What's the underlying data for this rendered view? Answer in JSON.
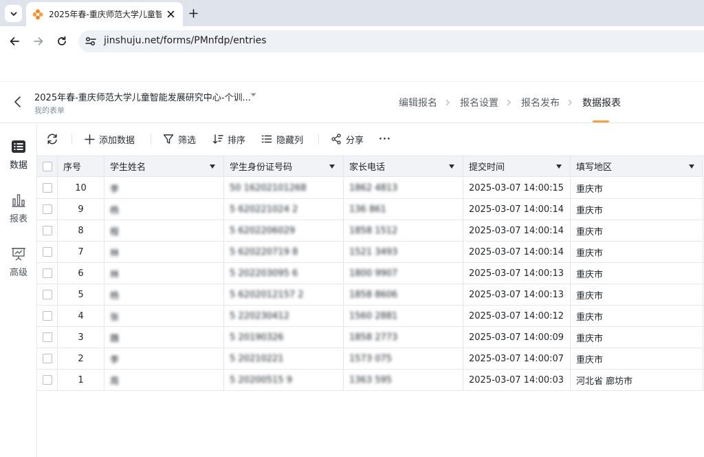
{
  "browser": {
    "tab_title": "2025年春-重庆师范大学儿童智",
    "url": "jinshuju.net/forms/PMnfdp/entries"
  },
  "header": {
    "form_title": "2025年春-重庆师范大学儿童智能发展研究中心-个训...",
    "subtitle": "我的表单",
    "steps": [
      "编辑报名",
      "报名设置",
      "报名发布",
      "数据报表"
    ],
    "active_step": "数据报表"
  },
  "rail": {
    "items": [
      {
        "label": "数据",
        "icon": "list-icon",
        "active": true
      },
      {
        "label": "报表",
        "icon": "bar-chart-icon",
        "active": false
      },
      {
        "label": "高级",
        "icon": "presentation-icon",
        "active": false
      }
    ]
  },
  "toolbar": {
    "add_label": "添加数据",
    "filter_label": "筛选",
    "sort_label": "排序",
    "hide_label": "隐藏列",
    "share_label": "分享",
    "more_label": "···"
  },
  "table": {
    "columns": [
      "序号",
      "学生姓名",
      "学生身份证号码",
      "家长电话",
      "提交时间",
      "填写地区"
    ],
    "rows": [
      {
        "seq": "10",
        "name": "李",
        "id": "50 16202101268",
        "phone": "1862 4813",
        "time": "2025-03-07 14:00:15",
        "region": "重庆市"
      },
      {
        "seq": "9",
        "name": "杨",
        "id": "5 620221024 2",
        "phone": "136 861",
        "time": "2025-03-07 14:00:14",
        "region": "重庆市"
      },
      {
        "seq": "8",
        "name": "程",
        "id": "5 6202206029",
        "phone": "1858 1512",
        "time": "2025-03-07 14:00:14",
        "region": "重庆市"
      },
      {
        "seq": "7",
        "name": "林",
        "id": "5 620220719 8",
        "phone": "1521 3493",
        "time": "2025-03-07 14:00:14",
        "region": "重庆市"
      },
      {
        "seq": "6",
        "name": "林",
        "id": "5 202203095 6",
        "phone": "1800 9907",
        "time": "2025-03-07 14:00:13",
        "region": "重庆市"
      },
      {
        "seq": "5",
        "name": "杨",
        "id": "5 6202012157 2",
        "phone": "1858 8606",
        "time": "2025-03-07 14:00:13",
        "region": "重庆市"
      },
      {
        "seq": "4",
        "name": "张",
        "id": "5 220230412",
        "phone": "1560 2881",
        "time": "2025-03-07 14:00:12",
        "region": "重庆市"
      },
      {
        "seq": "3",
        "name": "魏",
        "id": "5 20190326",
        "phone": "1858 2773",
        "time": "2025-03-07 14:00:09",
        "region": "重庆市"
      },
      {
        "seq": "2",
        "name": "李",
        "id": "5 20210221",
        "phone": "1573 075",
        "time": "2025-03-07 14:00:07",
        "region": "重庆市"
      },
      {
        "seq": "1",
        "name": "周",
        "id": "5 20200515 9",
        "phone": "1363 595",
        "time": "2025-03-07 14:00:03",
        "region": "河北省 廊坊市"
      }
    ]
  },
  "colors": {
    "accent": "#f5a042",
    "header_bg": "#f1f3f6",
    "tabbar_bg": "#dfe3eb"
  }
}
